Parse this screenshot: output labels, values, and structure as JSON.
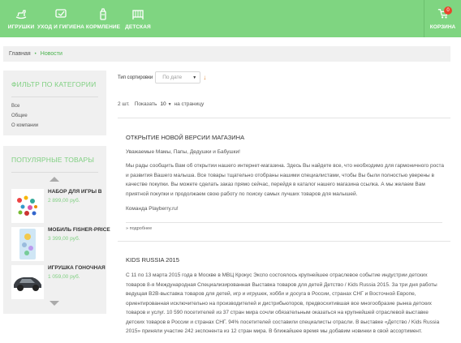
{
  "nav": {
    "items": [
      {
        "label": "ИГРУШКИ",
        "icon": "rocking-horse-icon"
      },
      {
        "label": "УХОД И ГИГИЕНА",
        "icon": "care-hand-icon"
      },
      {
        "label": "КОРМЛЕНИЕ",
        "icon": "baby-bottle-icon"
      },
      {
        "label": "ДЕТСКАЯ",
        "icon": "crib-icon"
      }
    ],
    "cart": {
      "label": "КОРЗИНА",
      "count": "0",
      "icon": "cart-icon"
    }
  },
  "breadcrumb": {
    "home": "Главная",
    "separator": "•",
    "current": "Новости"
  },
  "filter": {
    "title": "ФИЛЬТР ПО КАТЕГОРИИ",
    "items": [
      "Все",
      "Общие",
      "О компании"
    ]
  },
  "popular": {
    "title": "ПОПУЛЯРНЫЕ ТОВАРЫ",
    "products": [
      {
        "name": "НАБОР ДЛЯ ИГРЫ В",
        "price": "2 899,00 руб."
      },
      {
        "name": "МОБИЛЬ FISHER-PRICE",
        "price": "3 399,00 руб."
      },
      {
        "name": "ИГРУШКА ГОНОЧНАЯ",
        "price": "1 059,00 руб."
      }
    ]
  },
  "sort": {
    "label": "Тип сортировки",
    "value": "По дате",
    "direction": "↓"
  },
  "paging": {
    "count": "2 шт.",
    "show_label": "Показать",
    "per_page": "10",
    "suffix": "на страницу"
  },
  "articles": [
    {
      "title": "ОТКРЫТИЕ НОВОЙ ВЕРСИИ МАГАЗИНА",
      "paragraphs": [
        "Уважаемые Мамы, Папы, Дедушки и Бабушки!",
        "Мы рады сообщить Вам об открытии нашего интернет-магазина. Здесь Вы найдете все, что необходимо для гармоничного роста и развития Вашего малыша. Все товары тщательно отобраны нашими специалистами, чтобы Вы были полностью уверены в качестве покупки. Вы можете сделать заказ прямо сейчас, перейдя в каталог нашего магазина ссылка. А мы желаем Вам приятной покупки и продолжаем свою работу по поиску самых лучших товаров для малышей.",
        "Команда Playberry.ru!"
      ],
      "more": "» подробнее"
    },
    {
      "title": "KIDS RUSSIA 2015",
      "paragraphs": [
        "С 11 по 13 марта 2015 года в Москве в МВЦ Крокус Экспо состоялось крупнейшее отраслевое событие индустрии детских товаров 8-я Международная Специализированная Выставка товаров для детей Детство / Kids Russia 2015. За три дня работы ведущая B2B-выставка товаров для детей, игр и игрушек, хобби и досуга в России, странах СНГ и Восточной Европе, ориентированная исключительно на производителей и дистрибьюторов, предвосхитившая все многообразие рынка детских товаров и услуг. 10 590 посетителей из 37 стран мира сочли обязательным оказаться на крупнейшей отраслевой выставке детских товаров в России и странах СНГ. 94% посетителей составили специалисты отрасли. В выставке «Детство / Kids Russia 2015» приняли участие 242 экспонента из 12 стран мира. В ближайшее время мы добавим новинки в свой ассортимент."
      ]
    }
  ],
  "colors": {
    "brand_green": "#7fd581",
    "accent_green": "#4ab34d",
    "badge_red": "#e8452c",
    "sort_arrow": "#e08a3c"
  }
}
